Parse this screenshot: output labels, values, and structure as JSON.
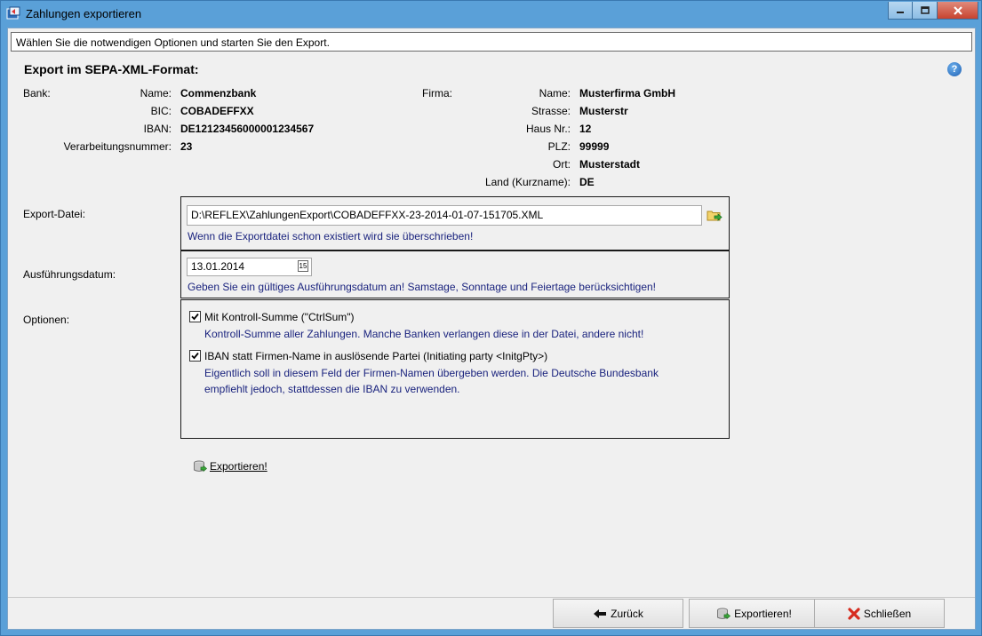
{
  "window": {
    "title": "Zahlungen exportieren"
  },
  "hint": "Wählen Sie die notwendigen Optionen und starten Sie den Export.",
  "heading": "Export im SEPA-XML-Format:",
  "bank": {
    "section_label": "Bank:",
    "name_label": "Name:",
    "name": "Commenzbank",
    "bic_label": "BIC:",
    "bic": "COBADEFFXX",
    "iban_label": "IBAN:",
    "iban": "DE12123456000001234567",
    "vnr_label": "Verarbeitungsnummer:",
    "vnr": "23"
  },
  "firma": {
    "section_label": "Firma:",
    "name_label": "Name:",
    "name": "Musterfirma GmbH",
    "strasse_label": "Strasse:",
    "strasse": "Musterstr",
    "hausnr_label": "Haus Nr.:",
    "hausnr": "12",
    "plz_label": "PLZ:",
    "plz": "99999",
    "ort_label": "Ort:",
    "ort": "Musterstadt",
    "land_label": "Land (Kurzname):",
    "land": "DE"
  },
  "export_file": {
    "label": "Export-Datei:",
    "value": "D:\\REFLEX\\ZahlungenExport\\COBADEFFXX-23-2014-01-07-151705.XML",
    "note": "Wenn die Exportdatei schon existiert wird sie überschrieben!"
  },
  "execution_date": {
    "label": "Ausführungsdatum:",
    "value": "13.01.2014",
    "note": "Geben Sie ein gültiges Ausführungsdatum an! Samstage, Sonntage und Feiertage berücksichtigen!"
  },
  "options": {
    "label": "Optionen:",
    "ctrlsum": {
      "checked": true,
      "label": "Mit Kontroll-Summe (\"CtrlSum\")",
      "note": "Kontroll-Summe aller Zahlungen. Manche Banken verlangen diese in der Datei, andere nicht!"
    },
    "iban": {
      "checked": true,
      "label": "IBAN statt Firmen-Name in auslösende Partei (Initiating party <InitgPty>)",
      "note_line1": "Eigentlich soll in diesem Feld der Firmen-Namen übergeben werden. Die Deutsche Bundesbank",
      "note_line2": "empfiehlt jedoch, stattdessen die IBAN zu verwenden."
    }
  },
  "export_link": "Exportieren!",
  "buttons": {
    "back": "Zurück",
    "export": "Exportieren!",
    "close": "Schließen"
  },
  "calendar_icon_text": "15",
  "help_icon_text": "?"
}
